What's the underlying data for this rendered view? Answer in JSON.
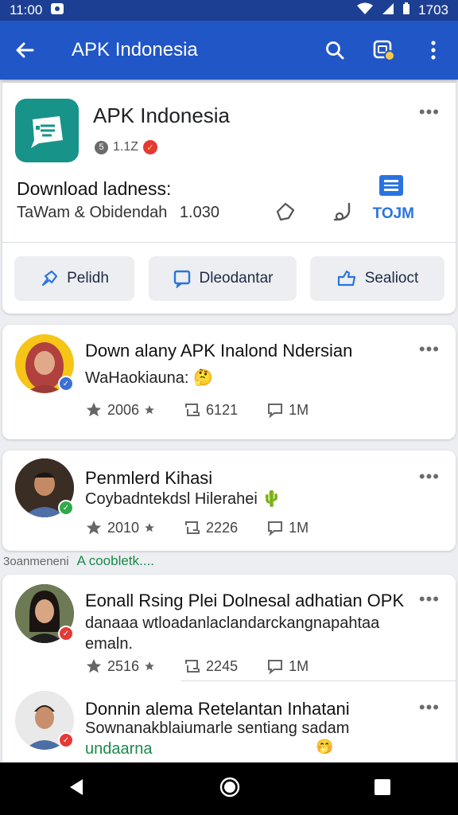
{
  "status_bar": {
    "time": "11:00",
    "battery": "1703"
  },
  "app_bar": {
    "title": "APK Indonesia"
  },
  "app_header": {
    "name": "APK Indonesia",
    "meta_count": "1.1Z",
    "meta_dot_num": "5",
    "download_label": "Download ladness:",
    "download_sub": "TaWam & Obidendah",
    "download_count": "1.030",
    "term_label": "TOJM",
    "buttons": [
      {
        "label": "Pelidh",
        "icon": "pin-icon"
      },
      {
        "label": "Dleodantar",
        "icon": "chat-icon"
      },
      {
        "label": "Sealioct",
        "icon": "share-icon"
      }
    ]
  },
  "posts": [
    {
      "title": "Down alany APK Inalond Ndersian",
      "text": "WaHaokiauna:",
      "likes": "2006",
      "reposts": "6121",
      "comments": "1M",
      "badge_color": "#3b6fd8"
    },
    {
      "title": "Penmlerd Kihasi",
      "text": "Coybadntekdsl Hilerahei",
      "likes": "2010",
      "reposts": "2226",
      "comments": "1M",
      "badge_color": "#2eaa4a"
    },
    {
      "title": "Eonall Rsing Plei Dolnesal adhatian OPK",
      "text": "danaaa wtloadanlaclandarckangnapahtaa emaln.",
      "likes": "2516",
      "reposts": "2245",
      "comments": "1M",
      "badge_color": "#e53935"
    },
    {
      "title": "Donnin alema Retelantan Inhatani",
      "text": "Sownanakblaiumarle sentiang sadam",
      "link": "undaarna",
      "badge_color": "#e53935"
    }
  ],
  "separator": {
    "text": "3oanmeneni",
    "link": "A coobletk...."
  },
  "colors": {
    "status_bar": "#1d3f93",
    "app_bar": "#2156c7",
    "app_icon": "#18938a",
    "accent": "#2a74e0"
  }
}
